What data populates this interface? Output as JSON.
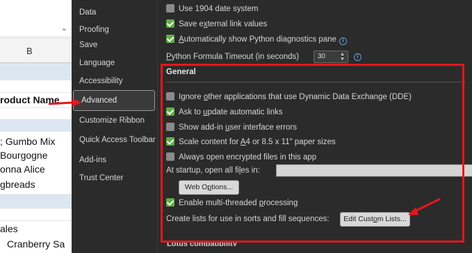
{
  "sheet": {
    "column_header": "B",
    "cells": [
      {
        "text": "roduct Name",
        "bold": true,
        "band": false
      },
      {
        "text": "; Gumbo Mix",
        "bold": false,
        "band": false
      },
      {
        "text": "Bourgogne",
        "bold": false,
        "band": false
      },
      {
        "text": "onna Alice",
        "bold": false,
        "band": false
      },
      {
        "text": "gbreads",
        "bold": false,
        "band": false
      },
      {
        "text": "ales",
        "bold": false,
        "band": false
      },
      {
        "text": "Cranberry Sa",
        "bold": false,
        "band": false
      }
    ]
  },
  "nav": {
    "items": [
      {
        "label": "Data"
      },
      {
        "label": "Proofing"
      },
      {
        "label": "Save"
      },
      {
        "label": "Language"
      },
      {
        "label": "Accessibility"
      },
      {
        "label": "Advanced",
        "selected": true
      },
      {
        "label": "Customize Ribbon"
      },
      {
        "label": "Quick Access Toolbar"
      },
      {
        "label": "Add-ins"
      },
      {
        "label": "Trust Center"
      }
    ]
  },
  "top_options": {
    "use_1904": {
      "label": "Use 1904 date system",
      "checked": false
    },
    "save_external": {
      "label_pre": "Save e",
      "label_u": "x",
      "label_post": "ternal link values",
      "checked": true
    },
    "python_diag": {
      "label_u": "A",
      "label_post": "utomatically show Python diagnostics pane",
      "checked": true
    },
    "python_timeout": {
      "label_u": "P",
      "label_post": "ython Formula Timeout (in seconds)",
      "value": "30"
    }
  },
  "general": {
    "title": "General",
    "options": [
      {
        "pre": "Ignore ",
        "u": "o",
        "post": "ther applications that use Dynamic Data Exchange (DDE)",
        "checked": false
      },
      {
        "pre": "Ask to ",
        "u": "u",
        "post": "pdate automatic links",
        "checked": true
      },
      {
        "pre": "Show add-in ",
        "u": "u",
        "post": "ser interface errors",
        "checked": false
      },
      {
        "pre": "Scale content for ",
        "u": "A",
        "post": "4 or 8.5 x 11\" paper sizes",
        "checked": true
      },
      {
        "pre": "Always open encrypted files in this app",
        "u": "",
        "post": "",
        "checked": false
      }
    ],
    "startup_label": {
      "pre": "At startup, open all fi",
      "u": "l",
      "post": "es in:"
    },
    "web_options_button": {
      "pre": "Web O",
      "u": "p",
      "post": "tions..."
    },
    "multithreaded": {
      "pre": "Enable multi-threaded ",
      "u": "p",
      "post": "rocessing",
      "checked": true
    },
    "custom_lists_label": "Create lists for use in sorts and fill sequences:",
    "edit_custom_lists_button": {
      "pre": "Edit Cust",
      "u": "o",
      "post": "m Lists..."
    }
  },
  "next_section_partial": "Lotus compatibility",
  "annotation_color": "#e8161b"
}
